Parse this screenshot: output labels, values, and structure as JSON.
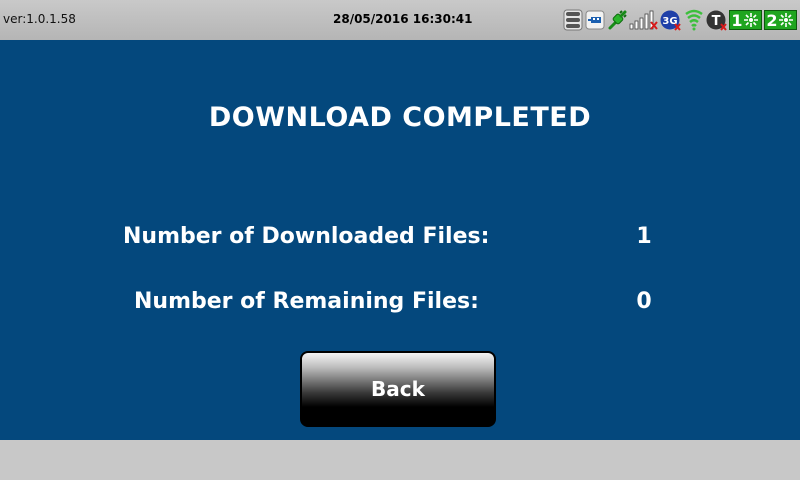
{
  "status_bar": {
    "version": "ver:1.0.1.58",
    "datetime": "28/05/2016 16:30:41",
    "icons": [
      {
        "name": "storage-icon"
      },
      {
        "name": "usb-icon"
      },
      {
        "name": "network-plug-icon"
      },
      {
        "name": "signal-bars-icon"
      },
      {
        "name": "3g-icon",
        "text": "3G"
      },
      {
        "name": "wifi-icon"
      },
      {
        "name": "printer-t-icon",
        "text": "T"
      },
      {
        "name": "channel-1-icon",
        "text": "1"
      },
      {
        "name": "channel-2-icon",
        "text": "2"
      }
    ],
    "colors": {
      "green_badge": "#1fa51f",
      "dark_badge": "#1a1a1a",
      "blue_badge": "#1e3fa8",
      "error_red": "#d61a1a"
    }
  },
  "main": {
    "title": "DOWNLOAD COMPLETED",
    "downloaded": {
      "label": "Number of Downloaded Files:",
      "value": "1"
    },
    "remaining": {
      "label": "Number of Remaining Files:",
      "value": "0"
    },
    "back_button": "Back",
    "background_color": "#04487d"
  }
}
